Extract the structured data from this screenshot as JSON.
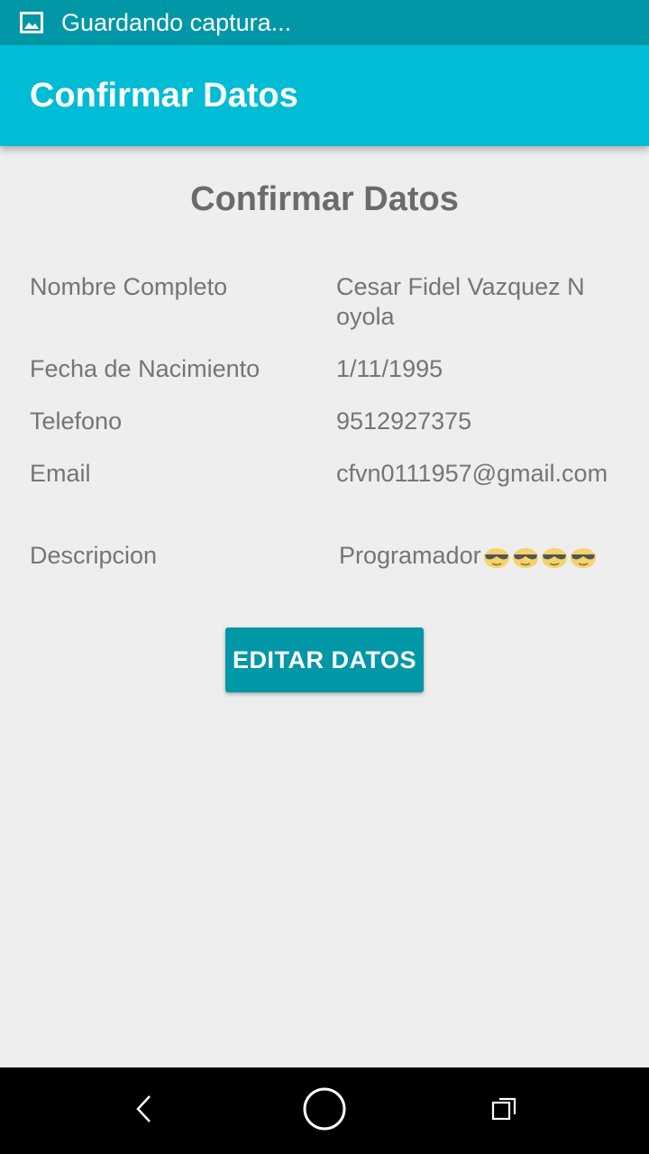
{
  "status_bar": {
    "notification_icon": "image-icon",
    "text": "Guardando captura..."
  },
  "app_bar": {
    "title": "Confirmar Datos"
  },
  "main": {
    "title": "Confirmar Datos",
    "fields": [
      {
        "label": "Nombre Completo",
        "value": "Cesar Fidel Vazquez Noyola"
      },
      {
        "label": "Fecha de Nacimiento",
        "value": "1/11/1995"
      },
      {
        "label": "Telefono",
        "value": "9512927375"
      },
      {
        "label": "Email",
        "value": "cfvn0111957@gmail.com"
      },
      {
        "label": "Descripcion",
        "value": "Programador",
        "emoji_icon": "sunglasses-face-emoji-icon",
        "emoji_count": 4
      }
    ],
    "edit_button_label": "EDITAR DATOS"
  },
  "nav_bar": {
    "back_icon": "back-icon",
    "home_icon": "home-icon",
    "recents_icon": "recents-icon"
  },
  "colors": {
    "status_bar": "#0097a7",
    "app_bar": "#00bcd4",
    "button": "#0097a7",
    "background": "#eeeeee",
    "text": "#757575"
  }
}
